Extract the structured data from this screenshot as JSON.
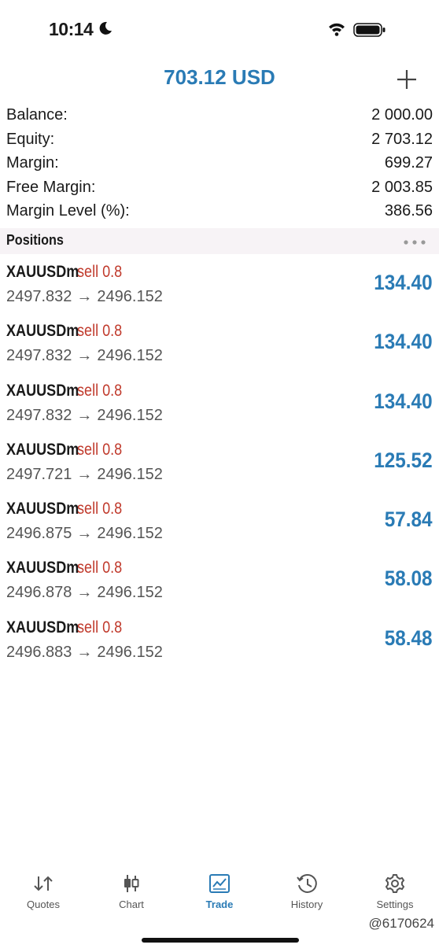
{
  "status_bar": {
    "time": "10:14"
  },
  "header": {
    "title": "703.12 USD"
  },
  "summary": [
    {
      "label": "Balance:",
      "value": "2 000.00"
    },
    {
      "label": "Equity:",
      "value": "2 703.12"
    },
    {
      "label": "Margin:",
      "value": "699.27"
    },
    {
      "label": "Free Margin:",
      "value": "2 003.85"
    },
    {
      "label": "Margin Level (%):",
      "value": "386.56"
    }
  ],
  "positions_title": "Positions",
  "positions": [
    {
      "symbol": "XAUUSDm",
      "side": "sell 0.8",
      "open": "2497.832",
      "current": "2496.152",
      "profit": "134.40"
    },
    {
      "symbol": "XAUUSDm",
      "side": "sell 0.8",
      "open": "2497.832",
      "current": "2496.152",
      "profit": "134.40"
    },
    {
      "symbol": "XAUUSDm",
      "side": "sell 0.8",
      "open": "2497.832",
      "current": "2496.152",
      "profit": "134.40"
    },
    {
      "symbol": "XAUUSDm",
      "side": "sell 0.8",
      "open": "2497.721",
      "current": "2496.152",
      "profit": "125.52"
    },
    {
      "symbol": "XAUUSDm",
      "side": "sell 0.8",
      "open": "2496.875",
      "current": "2496.152",
      "profit": "57.84"
    },
    {
      "symbol": "XAUUSDm",
      "side": "sell 0.8",
      "open": "2496.878",
      "current": "2496.152",
      "profit": "58.08"
    },
    {
      "symbol": "XAUUSDm",
      "side": "sell 0.8",
      "open": "2496.883",
      "current": "2496.152",
      "profit": "58.48"
    }
  ],
  "arrow": "→",
  "tabs": [
    {
      "label": "Quotes",
      "icon": "quotes-arrows-icon"
    },
    {
      "label": "Chart",
      "icon": "candlestick-icon"
    },
    {
      "label": "Trade",
      "icon": "trade-chart-icon",
      "active": true
    },
    {
      "label": "History",
      "icon": "history-clock-icon"
    },
    {
      "label": "Settings",
      "icon": "gear-icon"
    }
  ],
  "watermark": "@6170624",
  "colors": {
    "accent": "#2a7bb5",
    "sell": "#c0392b",
    "positions_header_bg": "#f7f3f6"
  }
}
